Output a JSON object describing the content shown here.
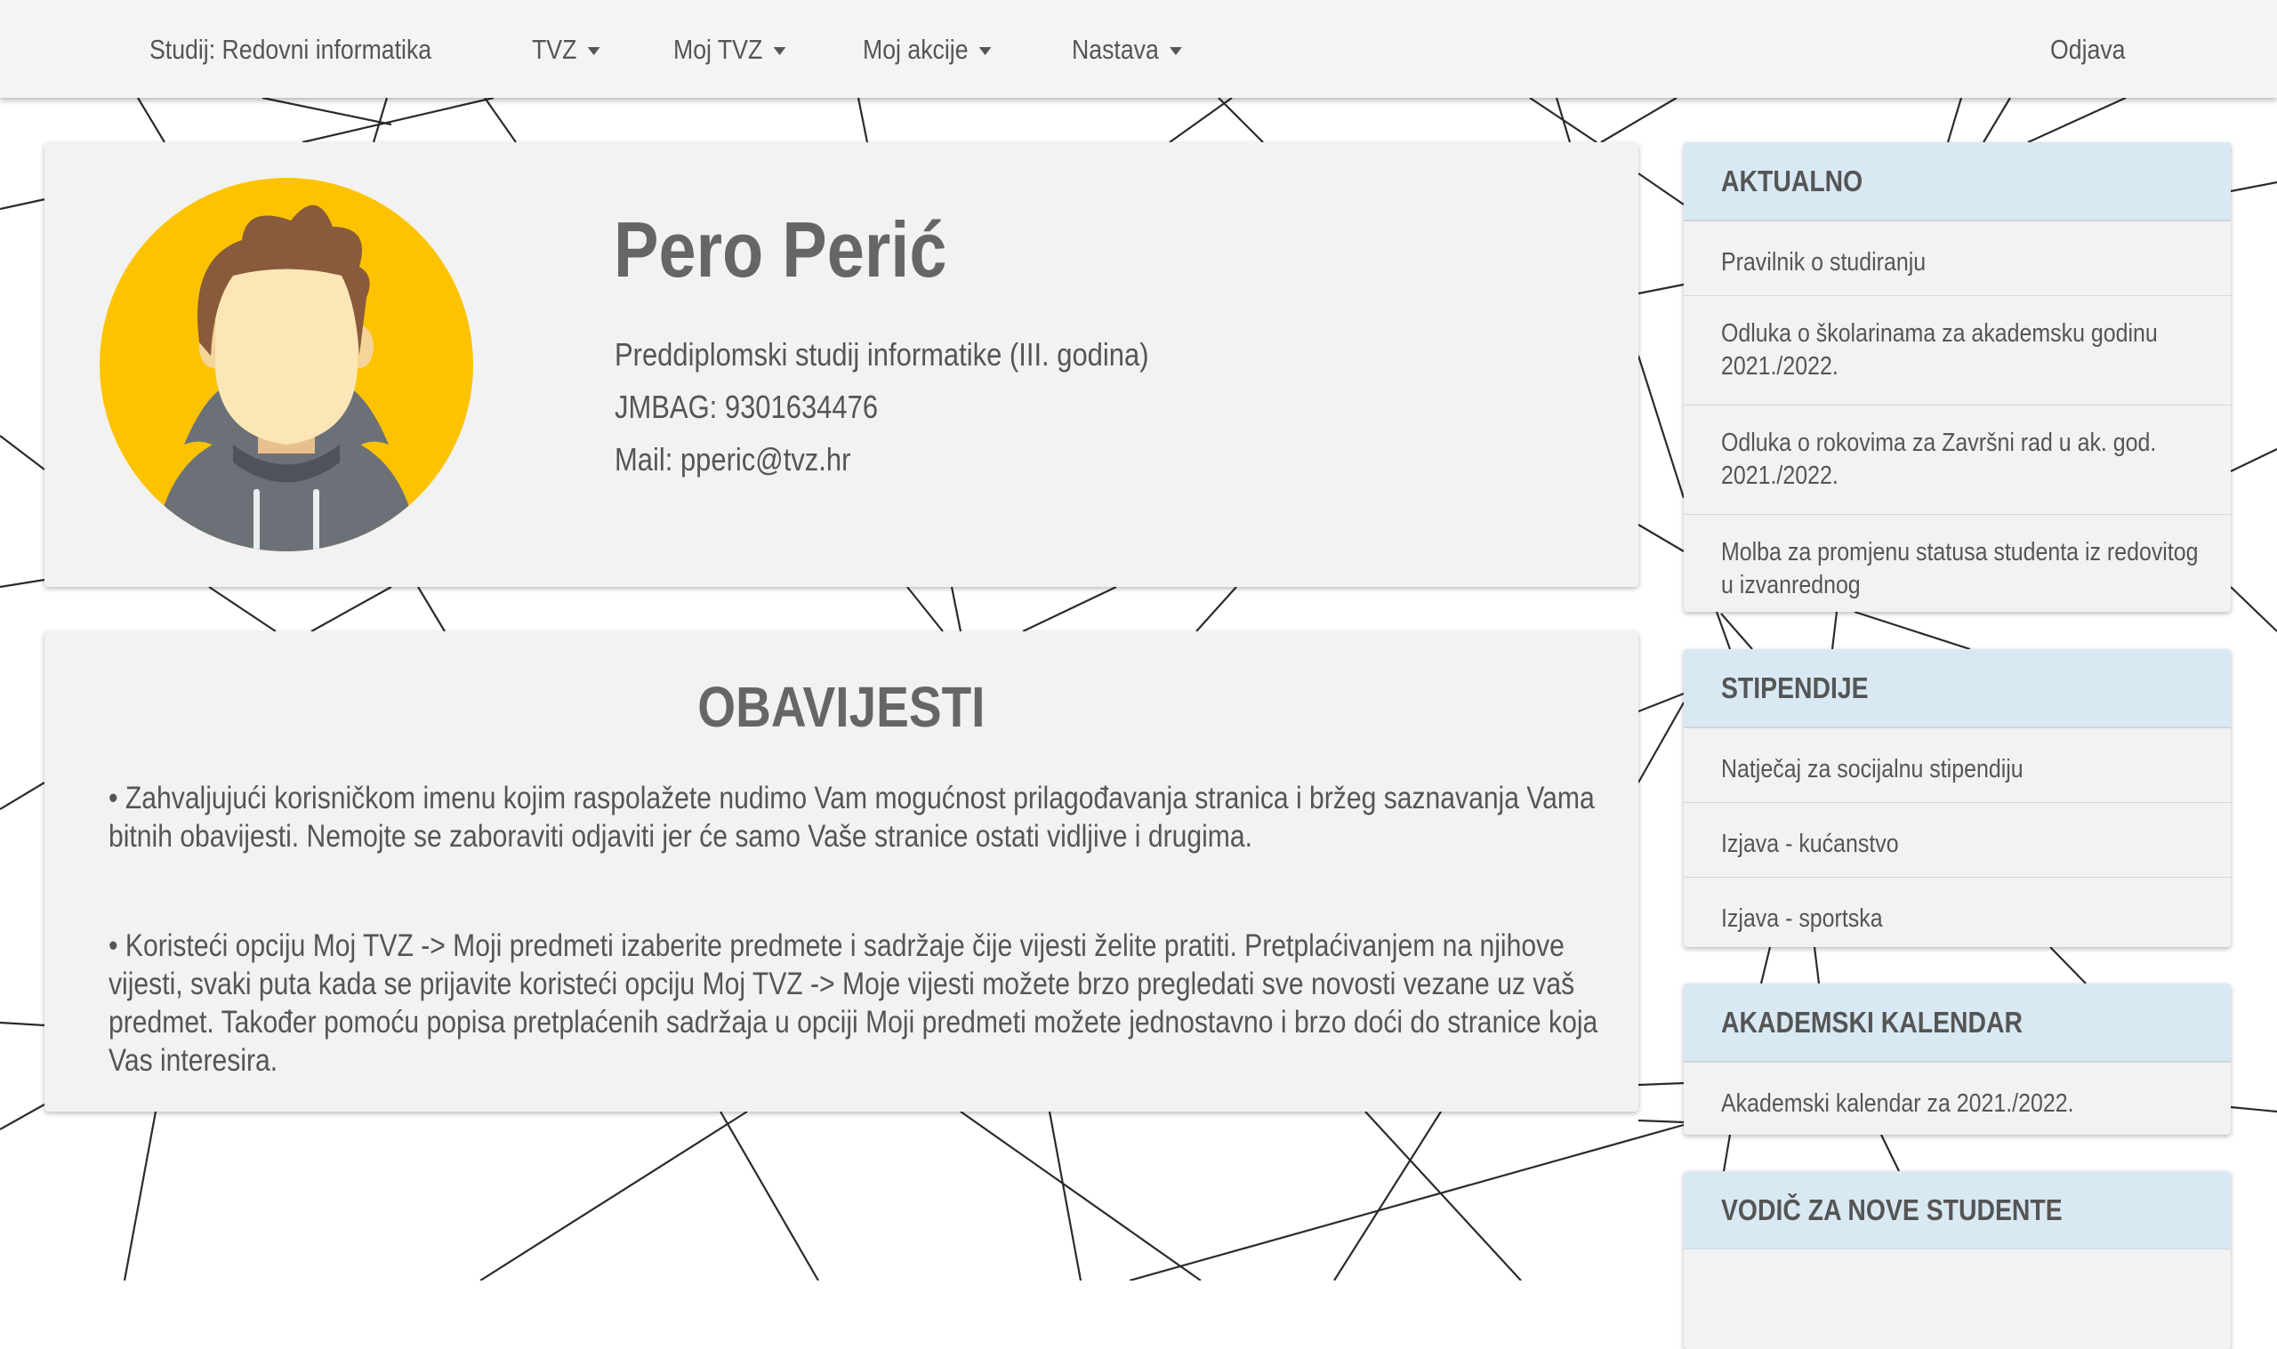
{
  "nav": {
    "study_label": "Studij: Redovni informatika",
    "items": [
      {
        "label": "TVZ"
      },
      {
        "label": "Moj TVZ"
      },
      {
        "label": "Moj akcije"
      },
      {
        "label": "Nastava"
      }
    ],
    "logout_label": "Odjava"
  },
  "profile": {
    "name": "Pero Perić",
    "study": "Preddiplomski studij informatike (III. godina)",
    "jmbag": "JMBAG: 9301634476",
    "mail": "Mail: pperic@tvz.hr"
  },
  "notices": {
    "title": "OBAVIJESTI",
    "paragraphs": [
      "• Zahvaljujući korisničkom imenu kojim raspolažete nudimo Vam mogućnost prilagođavanja stranica i bržeg saznavanja Vama bitnih obavijesti. Nemojte se zaboraviti odjaviti jer će samo Vaše stranice ostati vidljive i drugima.",
      "• Koristeći opciju Moj TVZ -> Moji predmeti izaberite predmete i sadržaje čije vijesti želite pratiti. Pretplaćivanjem na njihove vijesti, svaki puta kada se prijavite koristeći opciju Moj TVZ -> Moje vijesti možete brzo pregledati sve novosti vezane uz vaš predmet. Također pomoću popisa pretplaćenih sadržaja u opciji Moji predmeti možete jednostavno i brzo doći do stranice koja Vas interesira."
    ]
  },
  "sidebar": {
    "aktualno": {
      "title": "AKTUALNO",
      "items": [
        {
          "label": "Pravilnik o studiranju"
        },
        {
          "label": "Odluka o školarinama za akademsku godinu 2021./2022."
        },
        {
          "label": "Odluka o rokovima za Završni rad u ak. god. 2021./2022."
        },
        {
          "label": "Molba za promjenu statusa studenta iz redovitog u izvanrednog"
        }
      ]
    },
    "stipendije": {
      "title": "STIPENDIJE",
      "items": [
        {
          "label": "Natječaj za socijalnu stipendiju"
        },
        {
          "label": "Izjava - kućanstvo"
        },
        {
          "label": "Izjava - sportska"
        }
      ]
    },
    "kalendar": {
      "title": "AKADEMSKI KALENDAR",
      "items": [
        {
          "label": "Akademski kalendar za 2021./2022."
        }
      ]
    },
    "vodic": {
      "title": "VODIČ ZA NOVE STUDENTE"
    }
  },
  "colors": {
    "nav_bg": "#f4f4f4",
    "card_bg": "#f2f2f2",
    "panel_header_bg": "#d9e9f3",
    "avatar_bg": "#fdc300",
    "text": "#555555"
  },
  "icons": {
    "caret": "caret-down-icon",
    "avatar": "user-avatar-icon"
  }
}
